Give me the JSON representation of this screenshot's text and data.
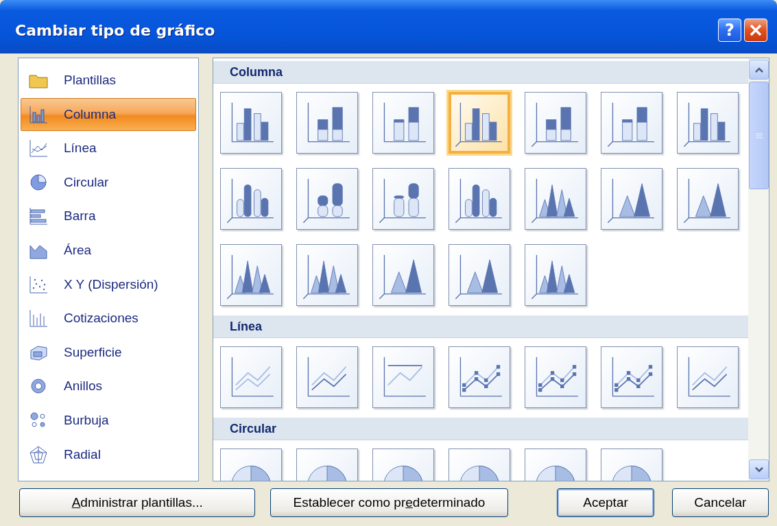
{
  "window": {
    "title": "Cambiar tipo de gráfico",
    "help": "?"
  },
  "categories": [
    {
      "label": "Plantillas",
      "selected": false
    },
    {
      "label": "Columna",
      "selected": true
    },
    {
      "label": "Línea",
      "selected": false
    },
    {
      "label": "Circular",
      "selected": false
    },
    {
      "label": "Barra",
      "selected": false
    },
    {
      "label": "Área",
      "selected": false
    },
    {
      "label": "X Y (Dispersión)",
      "selected": false
    },
    {
      "label": "Cotizaciones",
      "selected": false
    },
    {
      "label": "Superficie",
      "selected": false
    },
    {
      "label": "Anillos",
      "selected": false
    },
    {
      "label": "Burbuja",
      "selected": false
    },
    {
      "label": "Radial",
      "selected": false
    }
  ],
  "gallery": {
    "sections": [
      {
        "title": "Columna",
        "kind": "column",
        "items": [
          {
            "selected": false
          },
          {
            "selected": false
          },
          {
            "selected": false
          },
          {
            "selected": true
          },
          {
            "selected": false
          },
          {
            "selected": false
          },
          {
            "selected": false
          },
          {
            "selected": false
          },
          {
            "selected": false
          },
          {
            "selected": false
          },
          {
            "selected": false
          },
          {
            "selected": false
          },
          {
            "selected": false
          },
          {
            "selected": false
          },
          {
            "selected": false
          },
          {
            "selected": false
          },
          {
            "selected": false
          },
          {
            "selected": false
          },
          {
            "selected": false
          }
        ]
      },
      {
        "title": "Línea",
        "kind": "line",
        "items": [
          {
            "selected": false
          },
          {
            "selected": false
          },
          {
            "selected": false
          },
          {
            "selected": false
          },
          {
            "selected": false
          },
          {
            "selected": false
          },
          {
            "selected": false
          }
        ]
      },
      {
        "title": "Circular",
        "kind": "pie",
        "items": [
          {
            "selected": false
          },
          {
            "selected": false
          },
          {
            "selected": false
          },
          {
            "selected": false
          },
          {
            "selected": false
          },
          {
            "selected": false
          }
        ]
      }
    ]
  },
  "buttons": [
    {
      "kind": "secondary",
      "accesskey": "A",
      "text_after": "dministrar plantillas..."
    },
    {
      "kind": "secondary",
      "text_before": "Establecer como pr",
      "accesskey": "e",
      "text_after": "determinado"
    },
    {
      "kind": "default",
      "text_before": "Aceptar"
    },
    {
      "kind": "plain",
      "text_before": "Cancelar"
    }
  ]
}
